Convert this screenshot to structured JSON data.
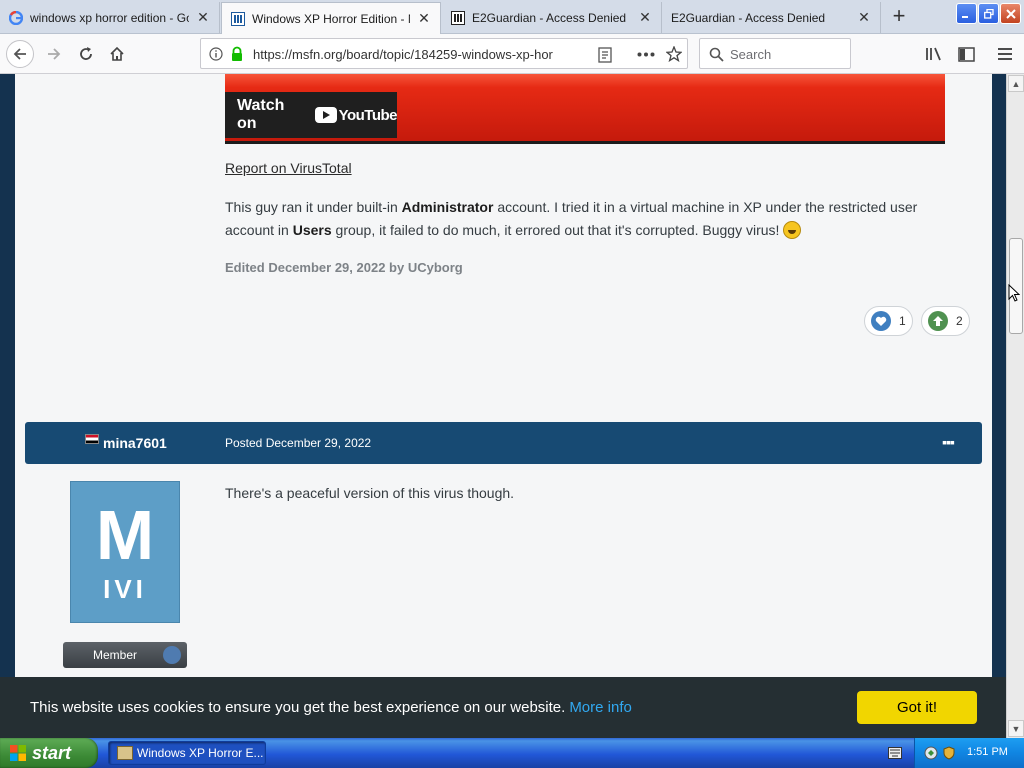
{
  "browser": {
    "tabs": [
      {
        "title": "windows xp horror edition - Google",
        "close": "✕",
        "icon": "google-icon"
      },
      {
        "title": "Windows XP Horror Edition - Malware",
        "close": "✕",
        "icon": "msfn-icon"
      },
      {
        "title": "E2Guardian - Access Denied",
        "close": "✕",
        "icon": "e2guardian-icon"
      },
      {
        "title": "E2Guardian - Access Denied",
        "close": "✕",
        "icon": "none"
      }
    ],
    "new_tab": "+",
    "url": "https://msfn.org/board/topic/184259-windows-xp-hor",
    "search_placeholder": "Search"
  },
  "page": {
    "video": {
      "watch_label": "Watch on",
      "yt_label": "YouTube"
    },
    "report_link": "Report on VirusTotal",
    "post": {
      "t1": "This guy ran it under built-in ",
      "b1": "Administrator",
      "t2": " account. I tried it in a virtual machine in XP under the restricted user account in ",
      "b2": "Users",
      "t3": " group, it failed to do much, it errored out that it's corrupted. Buggy virus! ",
      "edited": "Edited December 29, 2022 by UCyborg",
      "reactions": [
        {
          "icon": "heart-icon",
          "count": "1",
          "color": "#3f7fc0"
        },
        {
          "icon": "upvote-icon",
          "count": "2",
          "color": "#4f9150"
        }
      ]
    },
    "reply": {
      "author": "mina7601",
      "posted": "Posted December 29, 2022",
      "menu": "▪▪▪",
      "avatar_letter": "M",
      "avatar_sub": "IVI",
      "role": "Member",
      "text": "There's a peaceful version of this virus though."
    },
    "cookie": {
      "text": "This website uses cookies to ensure you get the best experience on our website.",
      "more": "More info",
      "ok": "Got it!"
    }
  },
  "taskbar": {
    "start": "start",
    "item": "Windows XP Horror E...",
    "clock": "1:51 PM"
  }
}
